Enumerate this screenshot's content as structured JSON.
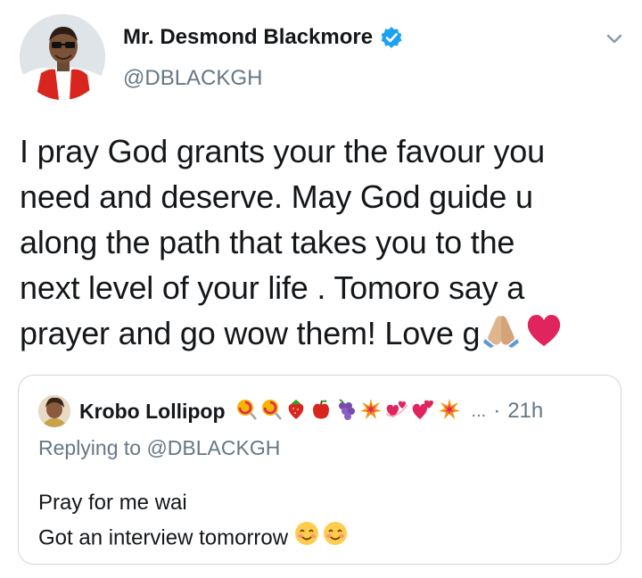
{
  "tweet": {
    "author_name": "Mr. Desmond Blackmore",
    "author_handle": "@DBLACKGH",
    "verified": true,
    "text_lines": [
      "I pray God grants your the favour you",
      "need and deserve. May God guide u",
      "along the path that takes you to the",
      "next level of your life . Tomoro say a",
      "prayer and go wow them! Love g"
    ],
    "trailing_emojis": [
      "folded-hands-emoji",
      "red-heart-emoji"
    ]
  },
  "quoted": {
    "author_name": "Krobo Lollipop",
    "name_emojis": [
      "lollipop",
      "lollipop",
      "strawberry",
      "apple",
      "grapes",
      "collision",
      "revolving-hearts",
      "two-hearts",
      "collision"
    ],
    "ellipsis": "...",
    "separator": "·",
    "time": "21h",
    "replying_to": "Replying to @DBLACKGH",
    "text_lines": [
      "Pray for me wai",
      "Got an interview tomorrow"
    ],
    "trailing_emojis": [
      "smiling-face-emoji",
      "smiling-face-emoji"
    ]
  },
  "colors": {
    "accent": "#1DA1F2",
    "secondary_text": "#657786",
    "border": "#CCD6DD",
    "heart": "#E0245E"
  }
}
